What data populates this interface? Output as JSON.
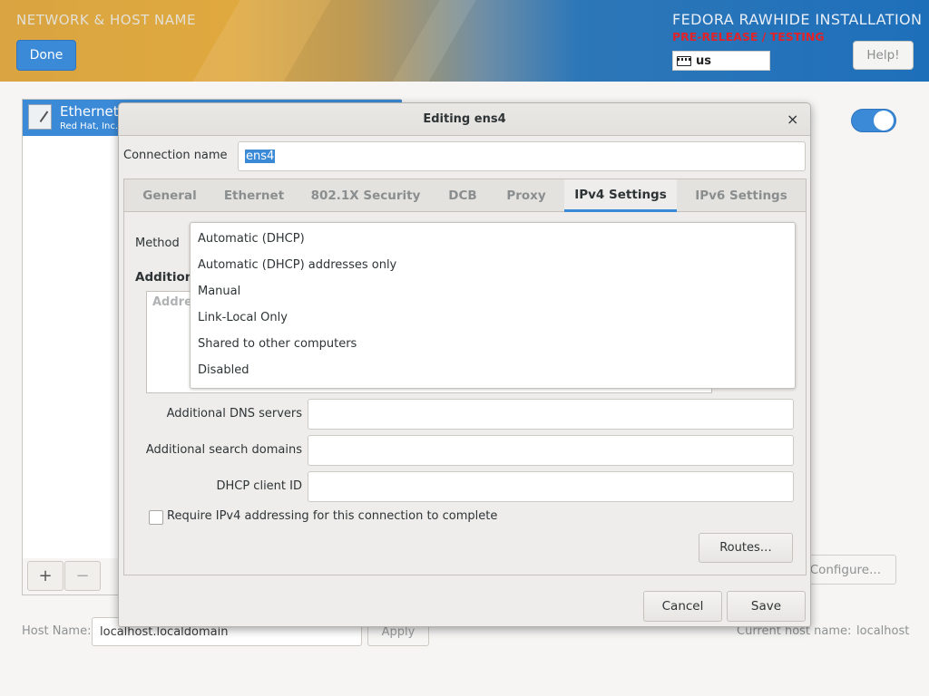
{
  "header": {
    "spoke_title": "NETWORK & HOST NAME",
    "done_label": "Done",
    "product_title": "FEDORA RAWHIDE INSTALLATION",
    "prerelease_label": "PRE-RELEASE / TESTING",
    "keyboard_layout": "us",
    "help_label": "Help!"
  },
  "devices": {
    "items": [
      {
        "name": "Ethernet",
        "vendor": "Red Hat, Inc. V"
      }
    ],
    "add_label": "+",
    "remove_label": "−",
    "toggle_on": true,
    "configure_label": "Configure..."
  },
  "hostname": {
    "label": "Host Name:",
    "value": "localhost.localdomain",
    "apply_label": "Apply",
    "current_label": "Current host name:",
    "current_value": "localhost"
  },
  "dialog": {
    "title": "Editing ens4",
    "close_glyph": "×",
    "connection_name_label": "Connection name",
    "connection_name_value": "ens4",
    "tabs": [
      {
        "label": "General"
      },
      {
        "label": "Ethernet"
      },
      {
        "label": "802.1X Security"
      },
      {
        "label": "DCB"
      },
      {
        "label": "Proxy"
      },
      {
        "label": "IPv4 Settings",
        "active": true
      },
      {
        "label": "IPv6 Settings"
      }
    ],
    "ipv4": {
      "method_label": "Method",
      "method_options": [
        "Automatic (DHCP)",
        "Automatic (DHCP) addresses only",
        "Manual",
        "Link-Local Only",
        "Shared to other computers",
        "Disabled"
      ],
      "additional_heading": "Addition",
      "address_column": "Addre",
      "dns_label": "Additional DNS servers",
      "dns_value": "",
      "search_label": "Additional search domains",
      "search_value": "",
      "dhcp_id_label": "DHCP client ID",
      "dhcp_id_value": "",
      "require_label": "Require IPv4 addressing for this connection to complete",
      "require_checked": false,
      "routes_label": "Routes…"
    },
    "cancel_label": "Cancel",
    "save_label": "Save"
  },
  "colors": {
    "accent": "#3b8ad8",
    "prerelease": "#e0232a"
  }
}
